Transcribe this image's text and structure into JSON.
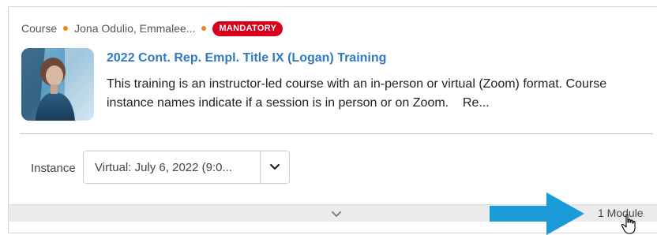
{
  "card": {
    "type_label": "Course",
    "authors": "Jona Odulio, Emmalee...",
    "badge": "MANDATORY",
    "title": "2022 Cont. Rep. Empl. Title IX (Logan) Training",
    "description": "This training is an instructor-led course with an in-person or virtual (Zoom) format. Course instance names indicate if a session is in person or on Zoom.",
    "read_more": "Re...",
    "thumbnail_icon": "course-thumbnail-photo"
  },
  "instance": {
    "label": "Instance",
    "selected": "Virtual: July 6, 2022 (9:0..."
  },
  "footer": {
    "module_count": "1 Module"
  },
  "colors": {
    "link": "#2e79c0",
    "badge": "#d9001b",
    "dot": "#f58220",
    "arrow": "#1a9bd7"
  }
}
